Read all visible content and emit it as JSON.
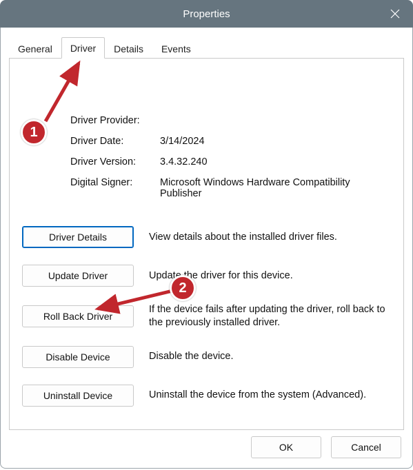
{
  "window": {
    "title": "Properties"
  },
  "tabs": {
    "general": "General",
    "driver": "Driver",
    "details": "Details",
    "events": "Events",
    "active": "driver"
  },
  "driver_info": {
    "provider_label": "Driver Provider:",
    "provider_value": "",
    "date_label": "Driver Date:",
    "date_value": "3/14/2024",
    "version_label": "Driver Version:",
    "version_value": "3.4.32.240",
    "signer_label": "Digital Signer:",
    "signer_value": "Microsoft Windows Hardware Compatibility Publisher"
  },
  "actions": {
    "details": {
      "label": "Driver Details",
      "desc": "View details about the installed driver files."
    },
    "update": {
      "label": "Update Driver",
      "desc": "Update the driver for this device."
    },
    "rollback": {
      "label": "Roll Back Driver",
      "desc": "If the device fails after updating the driver, roll back to the previously installed driver."
    },
    "disable": {
      "label": "Disable Device",
      "desc": "Disable the device."
    },
    "uninstall": {
      "label": "Uninstall Device",
      "desc": "Uninstall the device from the system (Advanced)."
    }
  },
  "footer": {
    "ok": "OK",
    "cancel": "Cancel"
  },
  "annotations": {
    "badge1": "1",
    "badge2": "2"
  }
}
